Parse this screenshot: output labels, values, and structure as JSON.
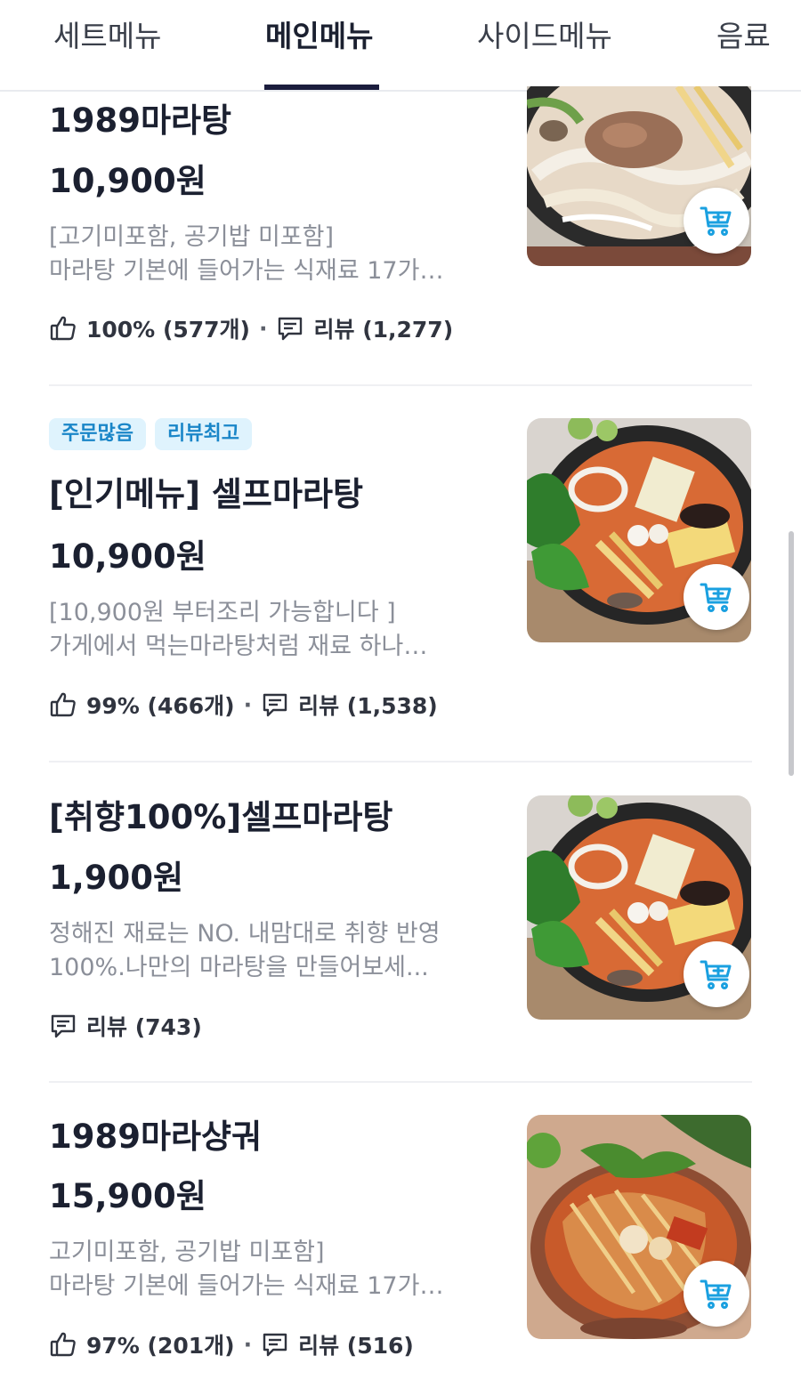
{
  "tabs": [
    {
      "label": "세트메뉴",
      "active": false
    },
    {
      "label": "메인메뉴",
      "active": true
    },
    {
      "label": "사이드메뉴",
      "active": false
    },
    {
      "label": "음료",
      "active": false
    }
  ],
  "items": [
    {
      "title": "1989마라탕",
      "price": "10,900원",
      "desc": [
        "[고기미포함, 공기밥 미포함]",
        "마라탕 기본에 들어가는 식재료 17가…"
      ],
      "like": "100% (577개)",
      "review": "리뷰 (1,277)"
    },
    {
      "badges": [
        "주문많음",
        "리뷰최고"
      ],
      "title": "[인기메뉴] 셀프마라탕",
      "price": "10,900원",
      "desc": [
        "[10,900원 부터조리 가능합니다 ]",
        "가게에서 먹는마라탕처럼 재료 하나…"
      ],
      "like": "99% (466개)",
      "review": "리뷰 (1,538)"
    },
    {
      "title": "[취향100%]셀프마라탕",
      "price": "1,900원",
      "desc": [
        "정해진 재료는 NO. 내맘대로 취향 반영",
        "100%.나만의 마라탕을 만들어보세..."
      ],
      "review": "리뷰 (743)"
    },
    {
      "title": "1989마라샹궈",
      "price": "15,900원",
      "desc": [
        "고기미포함, 공기밥 미포함]",
        "마라탕 기본에 들어가는 식재료 17가…"
      ],
      "like": "97% (201개)",
      "review": "리뷰 (516)"
    }
  ],
  "icons": {
    "like": "thumbs-up-icon",
    "review": "review-bubble-icon",
    "cart": "cart-add-icon"
  },
  "colors": {
    "accent_tab": "#1b1d3d",
    "cart_icon": "#1aa0e0",
    "badge_bg": "#dff3fd",
    "badge_text": "#1a86c8"
  }
}
